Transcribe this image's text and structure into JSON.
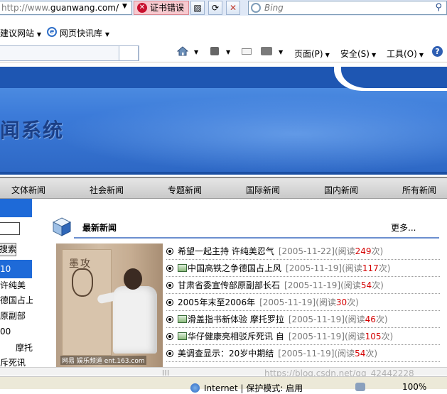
{
  "browser": {
    "address_url_scheme": "http://www.",
    "address_host": "guanwang.com/",
    "cert_error_label": "证书错误",
    "search_placeholder": "Bing",
    "favorites": {
      "suggested_sites": "建议网站",
      "web_slice_gallery": "网页快讯库"
    },
    "commands": {
      "page": "页面(P)",
      "safety": "安全(S)",
      "tools": "工具(O)"
    },
    "status": {
      "zone": "Internet | 保护模式: 启用",
      "zoom": "100%"
    }
  },
  "site": {
    "title": "闻系统",
    "nav": [
      "文体新闻",
      "社会新闻",
      "专题新闻",
      "国际新闻",
      "国内新闻",
      "所有新闻"
    ],
    "sidebar": {
      "search_button": "搜索",
      "highlight_text": "10",
      "lines": [
        "许纯美",
        "德国占上",
        "原副部",
        "00",
        "摩托",
        "斥死讯"
      ]
    },
    "latest": {
      "title": "最新新闻",
      "more": "更多...",
      "photo_caption": "网易 娱乐频道 ent.163.com",
      "items": [
        {
          "title": "希望一起主持 许纯美忍气",
          "date": "[2005-11-22]",
          "read_label": "(阅读",
          "count": "249",
          "suffix": "次)",
          "has_image": false
        },
        {
          "title": "中国高铁之争德国占上风",
          "date": "[2005-11-19]",
          "read_label": "(阅读",
          "count": "117",
          "suffix": "次)",
          "has_image": true
        },
        {
          "title": "甘肃省委宣传部原副部长石",
          "date": "[2005-11-19]",
          "read_label": "(阅读",
          "count": "54",
          "suffix": "次)",
          "has_image": false
        },
        {
          "title": "2005年末至2006年",
          "date": "[2005-11-19]",
          "read_label": "(阅读",
          "count": "30",
          "suffix": "次)",
          "has_image": false
        },
        {
          "title": "滑盖指书新体验 摩托罗拉",
          "date": "[2005-11-19]",
          "read_label": "(阅读",
          "count": "46",
          "suffix": "次)",
          "has_image": true
        },
        {
          "title": "华仔健康亮相驳斥死讯 自",
          "date": "[2005-11-19]",
          "read_label": "(阅读",
          "count": "105",
          "suffix": "次)",
          "has_image": true
        },
        {
          "title": "美调查显示：20岁中期结",
          "date": "[2005-11-19]",
          "read_label": "(阅读",
          "count": "54",
          "suffix": "次)",
          "has_image": false
        }
      ]
    }
  },
  "watermark": "https://blog.csdn.net/qq_42442228",
  "colors": {
    "banner_blue": "#2f6cc8",
    "nav_gray": "#d6d6d6",
    "count_red": "#d40000",
    "sidebar_blue": "#1e6ad8",
    "cert_error_bg": "#f7c9cf"
  }
}
